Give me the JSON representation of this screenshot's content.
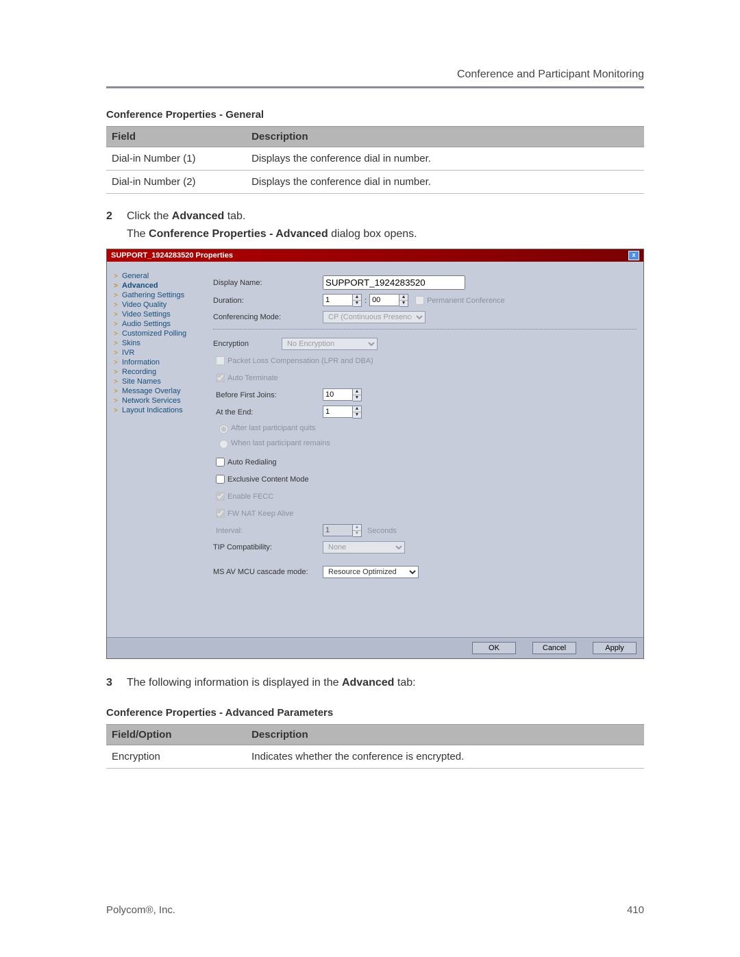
{
  "header": {
    "right": "Conference and Participant Monitoring"
  },
  "table1": {
    "title": "Conference Properties - General",
    "cols": {
      "field": "Field",
      "desc": "Description"
    },
    "rows": [
      {
        "field": "Dial-in Number (1)",
        "desc": "Displays the conference dial in number."
      },
      {
        "field": "Dial-in Number (2)",
        "desc": "Displays the conference dial in number."
      }
    ]
  },
  "steps": {
    "s2num": "2",
    "s2a": "Click the ",
    "s2b": "Advanced",
    "s2c": " tab.",
    "s2line2a": "The ",
    "s2line2b": "Conference Properties - Advanced",
    "s2line2c": " dialog box opens.",
    "s3num": "3",
    "s3a": "The following information is displayed in the ",
    "s3b": "Advanced",
    "s3c": " tab:"
  },
  "dialog": {
    "title": "SUPPORT_1924283520 Properties",
    "sidebar": [
      "General",
      "Advanced",
      "Gathering Settings",
      "Video Quality",
      "Video Settings",
      "Audio Settings",
      "Customized Polling",
      "Skins",
      "IVR",
      "Information",
      "Recording",
      "Site Names",
      "Message Overlay",
      "Network Services",
      "Layout Indications"
    ],
    "active_sidebar_index": 1,
    "labels": {
      "display_name": "Display Name:",
      "duration": "Duration:",
      "permanent": "Permanent Conference",
      "conf_mode": "Conferencing Mode:",
      "encryption": "Encryption",
      "plc": "Packet Loss Compensation (LPR and DBA)",
      "auto_term": "Auto Terminate",
      "before_first": "Before First Joins:",
      "at_end": "At the End:",
      "after_last_quits": "After last participant quits",
      "when_last_remains": "When last participant remains",
      "auto_redial": "Auto Redialing",
      "exclusive": "Exclusive Content Mode",
      "enable_fecc": "Enable FECC",
      "fw_nat": "FW NAT Keep Alive",
      "interval": "Interval:",
      "seconds": "Seconds",
      "tip": "TIP Compatibility:",
      "ms_av": "MS AV MCU cascade mode:"
    },
    "values": {
      "display_name": "SUPPORT_1924283520",
      "dur_h": "1",
      "dur_m": "00",
      "conf_mode": "CP (Continuous Presence)",
      "encryption": "No Encryption",
      "before_first": "10",
      "at_end": "1",
      "interval": "1",
      "tip": "None",
      "ms_av": "Resource Optimized"
    },
    "buttons": {
      "ok": "OK",
      "cancel": "Cancel",
      "apply": "Apply"
    }
  },
  "table2": {
    "title": "Conference Properties - Advanced Parameters",
    "cols": {
      "field": "Field/Option",
      "desc": "Description"
    },
    "rows": [
      {
        "field": "Encryption",
        "desc": "Indicates whether the conference is encrypted."
      }
    ]
  },
  "footer": {
    "left": "Polycom®, Inc.",
    "right": "410"
  }
}
